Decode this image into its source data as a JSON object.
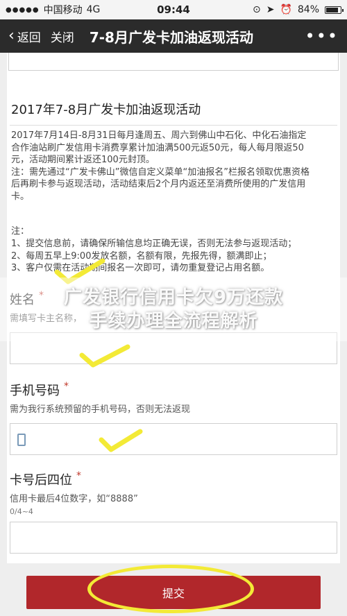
{
  "status_bar": {
    "carrier": "中国移动",
    "network": "4G",
    "time": "09:44",
    "battery": "84%",
    "icons": [
      "signal-dots-icon",
      "lock-rotation-icon",
      "location-arrow-icon",
      "alarm-icon",
      "battery-icon"
    ]
  },
  "nav": {
    "back_label": "返回",
    "close_label": "关闭",
    "title": "7-8月广发卡加油返现活动",
    "more_icon": "more-dots-icon"
  },
  "activity": {
    "title": "2017年7-8月广发卡加油返现活动",
    "desc_lines": [
      "2017年7月14日-8月31日每月逢周五、周六到佛山中石化、中化石油指定",
      "合作油站刷广发信用卡消费享累计加油满500元返50元，每人每月限返50",
      "元，活动期间累计返还100元封顶。",
      "注：需先通过“广发卡佛山”微信自定义菜单“加油报名”栏报名领取优惠资格",
      "后再刷卡参与返现活动，活动结束后2个月内返还至消费所使用的广发信用",
      "卡。"
    ],
    "notes_header": "注：",
    "notes": [
      "1、提交信息前，请确保所输信息均正确无误，否则无法参与返现活动；",
      "2、每周五早上9:00发放名额，名额有限，先报先得，额满即止；",
      "3、客户仅需在活动期间报名一次即可，请勿重复登记占用名额。"
    ]
  },
  "form": {
    "required_mark": "*",
    "name": {
      "label": "姓名",
      "help": "需填写卡主名称，"
    },
    "phone": {
      "label": "手机号码",
      "help": "需为我行系统预留的手机号码，否则无法返现"
    },
    "card": {
      "label": "卡号后四位",
      "help": "信用卡最后4位数字，如“8888”",
      "counter": "0/4~4"
    }
  },
  "submit_label": "提交",
  "watermark": {
    "line1": "广发银行信用卡欠9万还款",
    "line2": "手续办理全流程解析"
  },
  "colors": {
    "nav_bg": "#2b2b2b",
    "submit_bg": "#b1272b",
    "required": "#c0392b",
    "annotation": "#f3ea36"
  }
}
